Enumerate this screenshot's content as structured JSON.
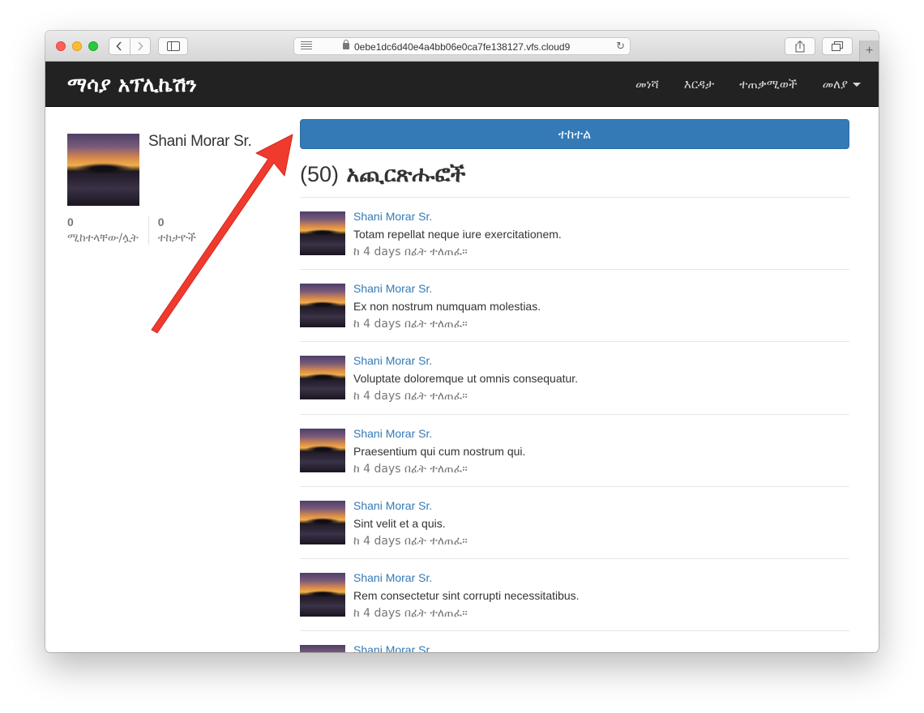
{
  "browser": {
    "url": "0ebe1dc6d40e4a4bb06e0ca7fe138127.vfs.cloud9",
    "back_icon": "chevron-left",
    "forward_icon": "chevron-right",
    "new_tab_label": "+"
  },
  "navbar": {
    "brand": "ማሳያ አፕሊኬሽን",
    "links": [
      {
        "label": "መነሻ"
      },
      {
        "label": "እርዳታ"
      },
      {
        "label": "ተጠቃሚወች"
      },
      {
        "label": "መለያ"
      }
    ]
  },
  "profile": {
    "name": "Shani Morar Sr.",
    "stats": [
      {
        "value": "0",
        "label": "ሚከተላቸው/ሏት"
      },
      {
        "value": "0",
        "label": "ተከታዮች"
      }
    ]
  },
  "follow_button": {
    "label": "ተከተል"
  },
  "feed": {
    "count": "(50)",
    "title": "አጪርጽሑፎች",
    "posts": [
      {
        "user": "Shani Morar Sr.",
        "body": "Totam repellat neque iure exercitationem.",
        "time": "ከ 4 days በፊት ተለጠፈ።"
      },
      {
        "user": "Shani Morar Sr.",
        "body": "Ex non nostrum numquam molestias.",
        "time": "ከ 4 days በፊት ተለጠፈ።"
      },
      {
        "user": "Shani Morar Sr.",
        "body": "Voluptate doloremque ut omnis consequatur.",
        "time": "ከ 4 days በፊት ተለጠፈ።"
      },
      {
        "user": "Shani Morar Sr.",
        "body": "Praesentium qui cum nostrum qui.",
        "time": "ከ 4 days በፊት ተለጠፈ።"
      },
      {
        "user": "Shani Morar Sr.",
        "body": "Sint velit et a quis.",
        "time": "ከ 4 days በፊት ተለጠፈ።"
      },
      {
        "user": "Shani Morar Sr.",
        "body": "Rem consectetur sint corrupti necessitatibus.",
        "time": "ከ 4 days በፊት ተለጠፈ።"
      },
      {
        "user": "Shani Morar Sr.",
        "body": "",
        "time": ""
      }
    ]
  },
  "colors": {
    "navbar_bg": "#222222",
    "primary": "#337ab7",
    "annotation_arrow": "#f03a2e"
  }
}
